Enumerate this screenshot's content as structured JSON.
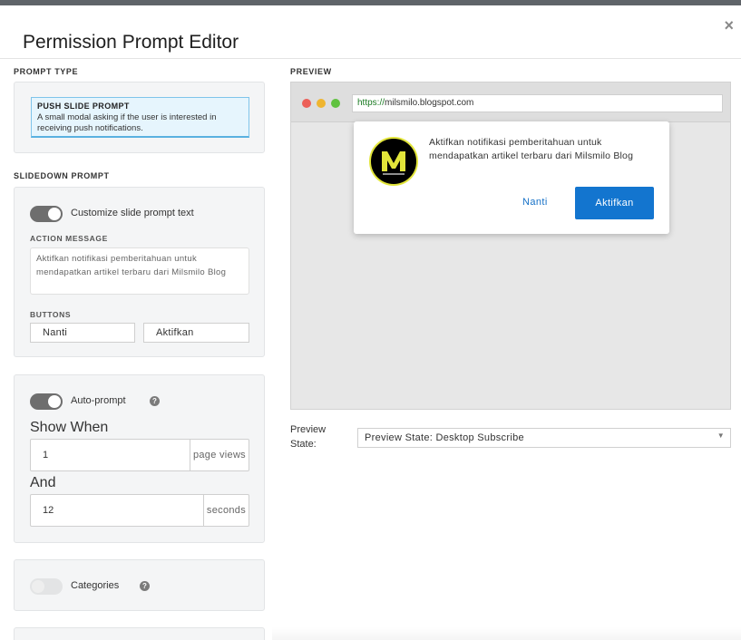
{
  "modal": {
    "title": "Permission Prompt Editor",
    "close_glyph": "×"
  },
  "prompt_type": {
    "section_label": "PROMPT TYPE",
    "card_title": "PUSH SLIDE PROMPT",
    "card_description": "A small modal asking if the user is interested in receiving push notifications."
  },
  "slidedown": {
    "section_label": "SLIDEDOWN PROMPT",
    "customize_toggle_on": true,
    "customize_label": "Customize slide prompt text",
    "action_message_label": "ACTION MESSAGE",
    "action_message_value": "Aktifkan notifikasi pemberitahuan untuk mendapatkan artikel terbaru dari Milsmilo Blog",
    "buttons_label": "BUTTONS",
    "button_cancel_value": "Nanti",
    "button_accept_value": "Aktifkan"
  },
  "auto_prompt": {
    "toggle_on": true,
    "label": "Auto-prompt",
    "show_when_label": "Show When",
    "page_views_value": "1",
    "page_views_unit": "page views",
    "and_label": "And",
    "seconds_value": "12",
    "seconds_unit": "seconds"
  },
  "categories": {
    "toggle_on": false,
    "label": "Categories"
  },
  "help_glyph": "?",
  "preview": {
    "section_label": "PREVIEW",
    "url_scheme": "https://",
    "url_host": "milsmilo.blogspot.com",
    "popup_message": "Aktifkan notifikasi pemberitahuan untuk mendapatkan artikel terbaru dari Milsmilo Blog",
    "popup_cancel": "Nanti",
    "popup_accept": "Aktifkan",
    "logo_letter": "M",
    "logo_tagline": "Milsmilo Blog",
    "state_label": "Preview State:",
    "state_value": "Preview State: Desktop Subscribe",
    "state_caret": "▼"
  },
  "icons": {
    "close": "close-icon",
    "help": "help-icon",
    "caret": "chevron-down-icon",
    "traffic_lights": [
      "#ec5f58",
      "#efb530",
      "#5fc23f"
    ]
  },
  "colors": {
    "accent": "#1375cf",
    "card_bg": "#e6f5fd",
    "card_border": "#7fc4ea",
    "logo_ring": "#e2e53a"
  }
}
